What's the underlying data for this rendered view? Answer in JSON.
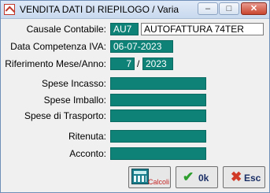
{
  "window": {
    "title": "VENDITA DATI DI RIEPILOGO / Varia",
    "minimize": "–",
    "maximize": "□",
    "close": "✕"
  },
  "form": {
    "causale_label": "Causale Contabile:",
    "causale_code": "AU7",
    "causale_desc": "AUTOFATTURA 74TER",
    "data_label": "Data Competenza IVA:",
    "data_value": "06-07-2023",
    "rif_label": "Riferimento Mese/Anno:",
    "rif_mese": "7",
    "rif_sep": "/",
    "rif_anno": "2023",
    "spese_incasso_label": "Spese Incasso:",
    "spese_incasso_value": "",
    "spese_imballo_label": "Spese Imballo:",
    "spese_imballo_value": "",
    "spese_trasporto_label": "Spese di Trasporto:",
    "spese_trasporto_value": "",
    "ritenuta_label": "Ritenuta:",
    "ritenuta_value": "",
    "acconto_label": "Acconto:",
    "acconto_value": ""
  },
  "buttons": {
    "calcoli": "Calcoli",
    "ok": "0k",
    "esc": "Esc",
    "calcoli_icon": "calculator-icon",
    "ok_icon": "checkmark-icon",
    "esc_icon": "cross-icon"
  },
  "colors": {
    "field_teal": "#0f8278",
    "button_text": "#1a2f66"
  }
}
